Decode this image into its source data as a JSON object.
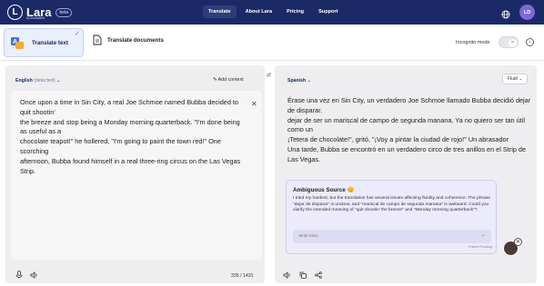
{
  "header": {
    "logo_letter": "L",
    "logo_text": "Lara",
    "logo_sub": "by translated",
    "beta": "beta",
    "nav": [
      "Translate",
      "About Lara",
      "Pricing",
      "Support"
    ],
    "active_nav": "Translate",
    "avatar_initials": "LD",
    "accent": "#1b2a66"
  },
  "tabs": {
    "translate_text": "Translate text",
    "translate_documents": "Translate documents",
    "incognito_label": "Incognito mode",
    "toggle_icon": "✕"
  },
  "source": {
    "language": "English",
    "detected": "(detected)",
    "add_context": "Add context",
    "text": "Once upon a time in Sin City, a real Joe Schmoe named Bubba decided to quit shootin'\nthe breeze and stop being a Monday morning quarterback. \"I'm done being as useful as a\nchocolate teapot!\" he hollered, \"I'm going to paint the town red!\" One scorching\nafternoon, Bubba found himself in a real three-ring circus on the Las Vegas Strip.",
    "char_count": "335 / 1431"
  },
  "target": {
    "language": "Spanish",
    "style": "Fluid",
    "text": "Érase una vez en Sin City, un verdadero Joe Schmoe llamado Bubba decidió dejar de disparar.\ndejar de ser un mariscal de campo de segunda manana. Ya no quiero ser tan útil como un\n¡Tetera de chocolate!\", gritó, \"¡Voy a pintar la ciudad de rojo!\" Un abrasador\nUna tarde, Bubba se encontró en un verdadero circo de tres anillos en el Strip de Las Vegas."
  },
  "ambiguous": {
    "title": "Ambiguous Source",
    "emoji": "😊",
    "body": "I tried my hardest, but the translation has several issues affecting fluidity and coherence. The phrase \"dejar de disparar\" is unclear, and \"mariscal de campo de segunda manana\" is awkward. Could you clarify the intended meaning of \"quit shootin' the breeze\" and \"Monday morning quarterback\"?",
    "placeholder": "Write here...",
    "patent": "Patent Pending"
  }
}
